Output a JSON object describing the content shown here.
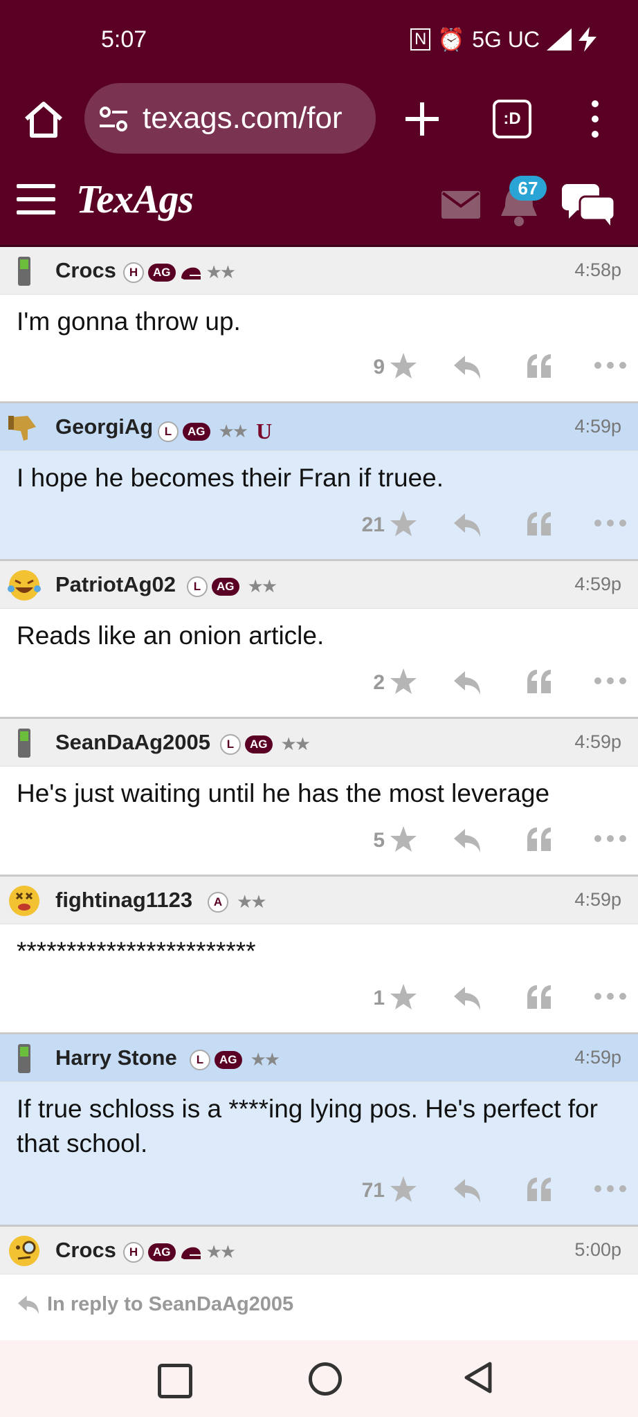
{
  "status": {
    "time": "5:07",
    "network": "5G UC",
    "nfc": "N"
  },
  "browser": {
    "url": "texags.com/for",
    "url_fade": "",
    "tabs_label": ":D"
  },
  "site": {
    "logo": "TexAgs",
    "notifications_count": "67"
  },
  "posts": [
    {
      "user": "Crocs",
      "badges": [
        "H",
        "AG",
        "helmet",
        "★★"
      ],
      "time": "4:58p",
      "body": "I'm gonna throw up.",
      "stars": "9",
      "highlight": false
    },
    {
      "user": "GeorgiAg",
      "badges": [
        "L",
        "AG",
        "★★",
        "U"
      ],
      "time": "4:59p",
      "body": "I hope he becomes their Fran if truee.",
      "stars": "21",
      "highlight": true
    },
    {
      "user": "PatriotAg02",
      "badges": [
        "L",
        "AG",
        "★★"
      ],
      "time": "4:59p",
      "body": "Reads like an onion article.",
      "stars": "2",
      "highlight": false
    },
    {
      "user": "SeanDaAg2005",
      "badges": [
        "L",
        "AG",
        "★★"
      ],
      "time": "4:59p",
      "body": "He's just waiting until he has the most leverage",
      "stars": "5",
      "highlight": false
    },
    {
      "user": "fightinag1123",
      "badges": [
        "A",
        "★★"
      ],
      "time": "4:59p",
      "body": "************************",
      "stars": "1",
      "highlight": false
    },
    {
      "user": "Harry Stone",
      "badges": [
        "L",
        "AG",
        "★★"
      ],
      "time": "4:59p",
      "body": "If true schloss is a ****ing lying pos. He's perfect for that school.",
      "stars": "71",
      "highlight": true
    },
    {
      "user": "Crocs",
      "badges": [
        "H",
        "AG",
        "helmet",
        "★★"
      ],
      "time": "5:00p",
      "reply_to": "In reply to SeanDaAg2005",
      "highlight": false
    }
  ],
  "colors": {
    "maroon": "#5a0024",
    "highlight": "#dceaf9",
    "badge_blue": "#2aa4d4"
  },
  "icons": [
    "home-icon",
    "tune-icon",
    "plus-icon",
    "tabs-icon",
    "more-vert-icon",
    "hamburger-icon",
    "mail-icon",
    "bell-icon",
    "chat-icon",
    "star-icon",
    "reply-icon",
    "quote-icon",
    "more-horiz-icon"
  ]
}
